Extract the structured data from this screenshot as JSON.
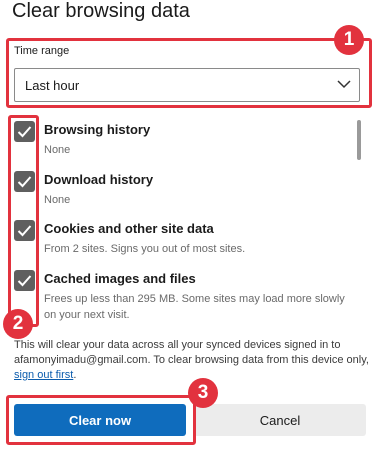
{
  "dialog": {
    "title": "Clear browsing data"
  },
  "time_range": {
    "label": "Time range",
    "value": "Last hour"
  },
  "items": [
    {
      "label": "Browsing history",
      "desc": "None",
      "checked": true
    },
    {
      "label": "Download history",
      "desc": "None",
      "checked": true
    },
    {
      "label": "Cookies and other site data",
      "desc": "From 2 sites. Signs you out of most sites.",
      "checked": true
    },
    {
      "label": "Cached images and files",
      "desc": "Frees up less than 295 MB. Some sites may load more slowly on your next visit.",
      "checked": true
    }
  ],
  "note": {
    "text": "This will clear your data across all your synced devices signed in to afamonyimadu@gmail.com. To clear browsing data from this device only,",
    "link": "sign out first",
    "end": "."
  },
  "buttons": {
    "clear": "Clear now",
    "cancel": "Cancel"
  },
  "annotations": {
    "badge1": "1",
    "badge2": "2",
    "badge3": "3"
  },
  "colors": {
    "accent": "#0f6cbd",
    "annotation": "#e2323e",
    "checkbox": "#5f5f5f"
  }
}
